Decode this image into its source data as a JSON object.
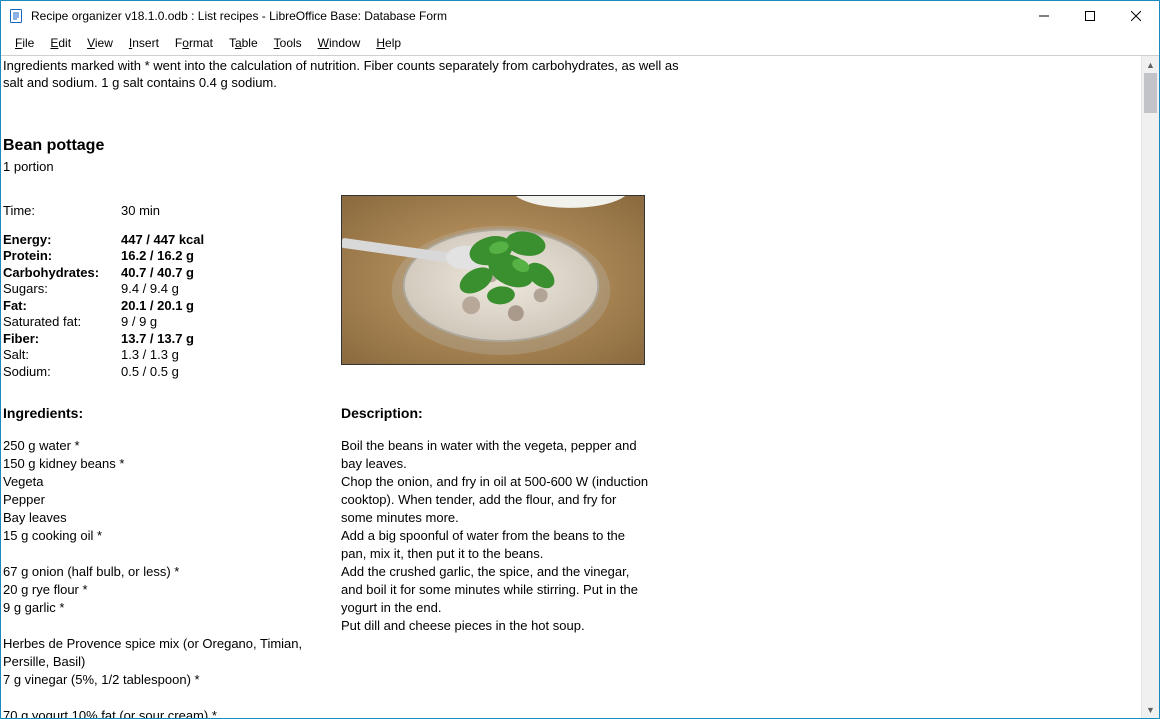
{
  "window": {
    "title": "Recipe organizer v18.1.0.odb : List recipes - LibreOffice Base: Database Form"
  },
  "menu": {
    "file": "File",
    "edit": "Edit",
    "view": "View",
    "insert": "Insert",
    "format": "Format",
    "table": "Table",
    "tools": "Tools",
    "window": "Window",
    "help": "Help"
  },
  "note_line1": "Ingredients marked with * went into the calculation of nutrition. Fiber counts separately from carbohydrates, as well as",
  "note_line2": "salt and sodium. 1 g salt contains 0.4 g sodium.",
  "recipe": {
    "title": "Bean pottage",
    "portion": "1 portion",
    "time_label": "Time:",
    "time_value": "30 min",
    "nutrition": [
      {
        "label": "Energy:",
        "value": "447 / 447 kcal",
        "bold": true
      },
      {
        "label": "Protein:",
        "value": "16.2 / 16.2 g",
        "bold": true
      },
      {
        "label": "Carbohydrates:",
        "value": "40.7 / 40.7 g",
        "bold": true
      },
      {
        "label": "Sugars:",
        "value": "9.4 / 9.4 g",
        "bold": false
      },
      {
        "label": "Fat:",
        "value": "20.1 / 20.1 g",
        "bold": true
      },
      {
        "label": "Saturated fat:",
        "value": "9 / 9 g",
        "bold": false
      },
      {
        "label": "Fiber:",
        "value": "13.7 / 13.7 g",
        "bold": true
      },
      {
        "label": "Salt:",
        "value": "1.3 / 1.3 g",
        "bold": false
      },
      {
        "label": "Sodium:",
        "value": "0.5 / 0.5 g",
        "bold": false
      }
    ],
    "ingredients_head": "Ingredients:",
    "ingredients": [
      "250 g water *",
      "150 g kidney beans *",
      "Vegeta",
      "Pepper",
      "Bay leaves",
      "15 g cooking oil *",
      "",
      "67 g onion (half bulb, or less) *",
      "20 g rye flour *",
      "9 g garlic *",
      "",
      "Herbes de Provence spice mix (or Oregano, Timian, Persille, Basil)",
      "7 g vinegar (5%, 1/2 tablespoon) *",
      "",
      "70 g yogurt 10% fat (or sour cream) *"
    ],
    "description_head": "Description:",
    "description": [
      "Boil the beans in water with the vegeta, pepper and bay leaves.",
      "Chop the onion, and fry in oil at 500-600 W (induction cooktop). When tender, add the flour, and fry for some minutes more.",
      "Add a big spoonful of water from the beans to the pan, mix it, then put it to the beans.",
      "Add the crushed garlic, the spice, and the vinegar, and boil it for some minutes while stirring. Put in the yogurt in the end.",
      "Put dill and cheese pieces in the hot soup."
    ]
  }
}
